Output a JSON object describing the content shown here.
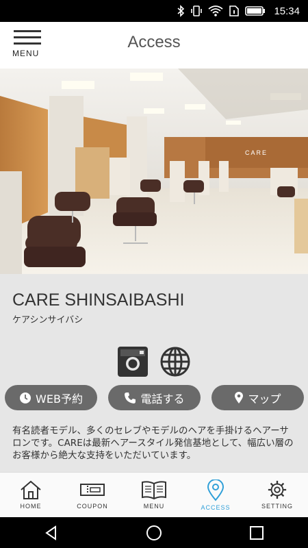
{
  "status_bar": {
    "time": "15:34"
  },
  "header": {
    "menu_label": "MENU",
    "title": "Access"
  },
  "salon": {
    "name": "CARE SHINSAIBASHI",
    "kana": "ケアシンサイバシ",
    "sign_text": "CARE"
  },
  "actions": {
    "web_reserve": "WEB予約",
    "phone": "電話する",
    "map": "マップ"
  },
  "description": "有名読者モデル、多くのセレブやモデルのヘアを手掛けるヘアーサロンです。CAREは最新ヘアースタイル発信基地として、幅広い層の お客様から絶大な支持をいただいています。",
  "tabs": [
    {
      "label": "HOME",
      "icon": "home-icon"
    },
    {
      "label": "COUPON",
      "icon": "coupon-icon"
    },
    {
      "label": "MENU",
      "icon": "book-icon"
    },
    {
      "label": "ACCESS",
      "icon": "pin-icon"
    },
    {
      "label": "SETTING",
      "icon": "gear-icon"
    }
  ],
  "colors": {
    "accent": "#2f9fd8",
    "pill": "#6a6a6a",
    "background": "#e6e6e6"
  }
}
